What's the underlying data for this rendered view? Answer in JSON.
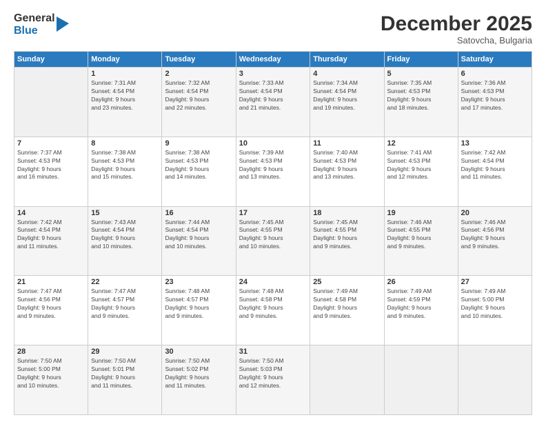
{
  "logo": {
    "general": "General",
    "blue": "Blue"
  },
  "header": {
    "month": "December 2025",
    "location": "Satovcha, Bulgaria"
  },
  "days_of_week": [
    "Sunday",
    "Monday",
    "Tuesday",
    "Wednesday",
    "Thursday",
    "Friday",
    "Saturday"
  ],
  "weeks": [
    [
      {
        "day": "",
        "info": ""
      },
      {
        "day": "1",
        "info": "Sunrise: 7:31 AM\nSunset: 4:54 PM\nDaylight: 9 hours\nand 23 minutes."
      },
      {
        "day": "2",
        "info": "Sunrise: 7:32 AM\nSunset: 4:54 PM\nDaylight: 9 hours\nand 22 minutes."
      },
      {
        "day": "3",
        "info": "Sunrise: 7:33 AM\nSunset: 4:54 PM\nDaylight: 9 hours\nand 21 minutes."
      },
      {
        "day": "4",
        "info": "Sunrise: 7:34 AM\nSunset: 4:54 PM\nDaylight: 9 hours\nand 19 minutes."
      },
      {
        "day": "5",
        "info": "Sunrise: 7:35 AM\nSunset: 4:53 PM\nDaylight: 9 hours\nand 18 minutes."
      },
      {
        "day": "6",
        "info": "Sunrise: 7:36 AM\nSunset: 4:53 PM\nDaylight: 9 hours\nand 17 minutes."
      }
    ],
    [
      {
        "day": "7",
        "info": "Sunrise: 7:37 AM\nSunset: 4:53 PM\nDaylight: 9 hours\nand 16 minutes."
      },
      {
        "day": "8",
        "info": "Sunrise: 7:38 AM\nSunset: 4:53 PM\nDaylight: 9 hours\nand 15 minutes."
      },
      {
        "day": "9",
        "info": "Sunrise: 7:38 AM\nSunset: 4:53 PM\nDaylight: 9 hours\nand 14 minutes."
      },
      {
        "day": "10",
        "info": "Sunrise: 7:39 AM\nSunset: 4:53 PM\nDaylight: 9 hours\nand 13 minutes."
      },
      {
        "day": "11",
        "info": "Sunrise: 7:40 AM\nSunset: 4:53 PM\nDaylight: 9 hours\nand 13 minutes."
      },
      {
        "day": "12",
        "info": "Sunrise: 7:41 AM\nSunset: 4:53 PM\nDaylight: 9 hours\nand 12 minutes."
      },
      {
        "day": "13",
        "info": "Sunrise: 7:42 AM\nSunset: 4:54 PM\nDaylight: 9 hours\nand 11 minutes."
      }
    ],
    [
      {
        "day": "14",
        "info": "Sunrise: 7:42 AM\nSunset: 4:54 PM\nDaylight: 9 hours\nand 11 minutes."
      },
      {
        "day": "15",
        "info": "Sunrise: 7:43 AM\nSunset: 4:54 PM\nDaylight: 9 hours\nand 10 minutes."
      },
      {
        "day": "16",
        "info": "Sunrise: 7:44 AM\nSunset: 4:54 PM\nDaylight: 9 hours\nand 10 minutes."
      },
      {
        "day": "17",
        "info": "Sunrise: 7:45 AM\nSunset: 4:55 PM\nDaylight: 9 hours\nand 10 minutes."
      },
      {
        "day": "18",
        "info": "Sunrise: 7:45 AM\nSunset: 4:55 PM\nDaylight: 9 hours\nand 9 minutes."
      },
      {
        "day": "19",
        "info": "Sunrise: 7:46 AM\nSunset: 4:55 PM\nDaylight: 9 hours\nand 9 minutes."
      },
      {
        "day": "20",
        "info": "Sunrise: 7:46 AM\nSunset: 4:56 PM\nDaylight: 9 hours\nand 9 minutes."
      }
    ],
    [
      {
        "day": "21",
        "info": "Sunrise: 7:47 AM\nSunset: 4:56 PM\nDaylight: 9 hours\nand 9 minutes."
      },
      {
        "day": "22",
        "info": "Sunrise: 7:47 AM\nSunset: 4:57 PM\nDaylight: 9 hours\nand 9 minutes."
      },
      {
        "day": "23",
        "info": "Sunrise: 7:48 AM\nSunset: 4:57 PM\nDaylight: 9 hours\nand 9 minutes."
      },
      {
        "day": "24",
        "info": "Sunrise: 7:48 AM\nSunset: 4:58 PM\nDaylight: 9 hours\nand 9 minutes."
      },
      {
        "day": "25",
        "info": "Sunrise: 7:49 AM\nSunset: 4:58 PM\nDaylight: 9 hours\nand 9 minutes."
      },
      {
        "day": "26",
        "info": "Sunrise: 7:49 AM\nSunset: 4:59 PM\nDaylight: 9 hours\nand 9 minutes."
      },
      {
        "day": "27",
        "info": "Sunrise: 7:49 AM\nSunset: 5:00 PM\nDaylight: 9 hours\nand 10 minutes."
      }
    ],
    [
      {
        "day": "28",
        "info": "Sunrise: 7:50 AM\nSunset: 5:00 PM\nDaylight: 9 hours\nand 10 minutes."
      },
      {
        "day": "29",
        "info": "Sunrise: 7:50 AM\nSunset: 5:01 PM\nDaylight: 9 hours\nand 11 minutes."
      },
      {
        "day": "30",
        "info": "Sunrise: 7:50 AM\nSunset: 5:02 PM\nDaylight: 9 hours\nand 11 minutes."
      },
      {
        "day": "31",
        "info": "Sunrise: 7:50 AM\nSunset: 5:03 PM\nDaylight: 9 hours\nand 12 minutes."
      },
      {
        "day": "",
        "info": ""
      },
      {
        "day": "",
        "info": ""
      },
      {
        "day": "",
        "info": ""
      }
    ]
  ]
}
